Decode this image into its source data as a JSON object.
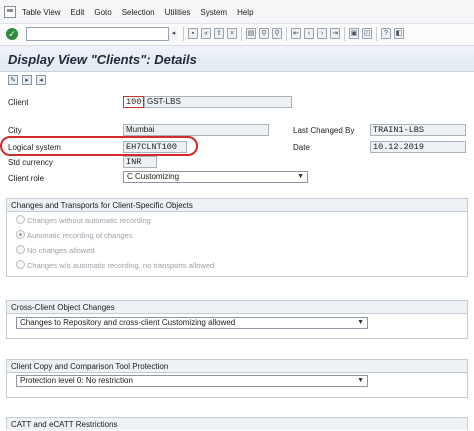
{
  "menu": {
    "items": [
      "Table View",
      "Edit",
      "Goto",
      "Selection",
      "Utilities",
      "System",
      "Help"
    ]
  },
  "toolbar": {
    "command_value": "",
    "icons": [
      "save-icon",
      "back-icon",
      "exit-icon",
      "cancel-icon",
      "print-icon",
      "find-icon",
      "find-next-icon",
      "first-page-icon",
      "previous-page-icon",
      "next-page-icon",
      "last-page-icon",
      "create-session-icon",
      "shortcut-icon",
      "help-icon",
      "customize-layout-icon"
    ]
  },
  "page": {
    "title": "Display View \"Clients\": Details"
  },
  "app_toolbar": {
    "icons": [
      "display-change-icon",
      "next-entry-icon",
      "previous-entry-icon"
    ]
  },
  "form": {
    "client_label": "Client",
    "client_value": "100",
    "client_name": "GST-LBS",
    "city_label": "City",
    "city_value": "Mumbai",
    "last_changed_by_label": "Last Changed By",
    "last_changed_by_value": "TRAIN1-LBS",
    "logical_system_label": "Logical system",
    "logical_system_value": "EH7CLNT100",
    "date_label": "Date",
    "date_value": "10.12.2019",
    "std_currency_label": "Std currency",
    "std_currency_value": "INR",
    "client_role_label": "Client role",
    "client_role_value": "C Customizing"
  },
  "changes_group": {
    "title": "Changes and Transports for Client-Specific Objects",
    "options": [
      {
        "label": "Changes without automatic recording",
        "selected": false
      },
      {
        "label": "Automatic recording of changes",
        "selected": true
      },
      {
        "label": "No changes allowed",
        "selected": false
      },
      {
        "label": "Changes w/o automatic recording, no transports allowed",
        "selected": false
      }
    ]
  },
  "cross_client_group": {
    "title": "Cross-Client Object Changes",
    "value": "Changes to Repository and cross-client Customizing allowed"
  },
  "copy_group": {
    "title": "Client Copy and Comparison Tool Protection",
    "value": "Protection level 0: No restriction"
  },
  "catt_group": {
    "title": "CATT and eCATT Restrictions"
  }
}
